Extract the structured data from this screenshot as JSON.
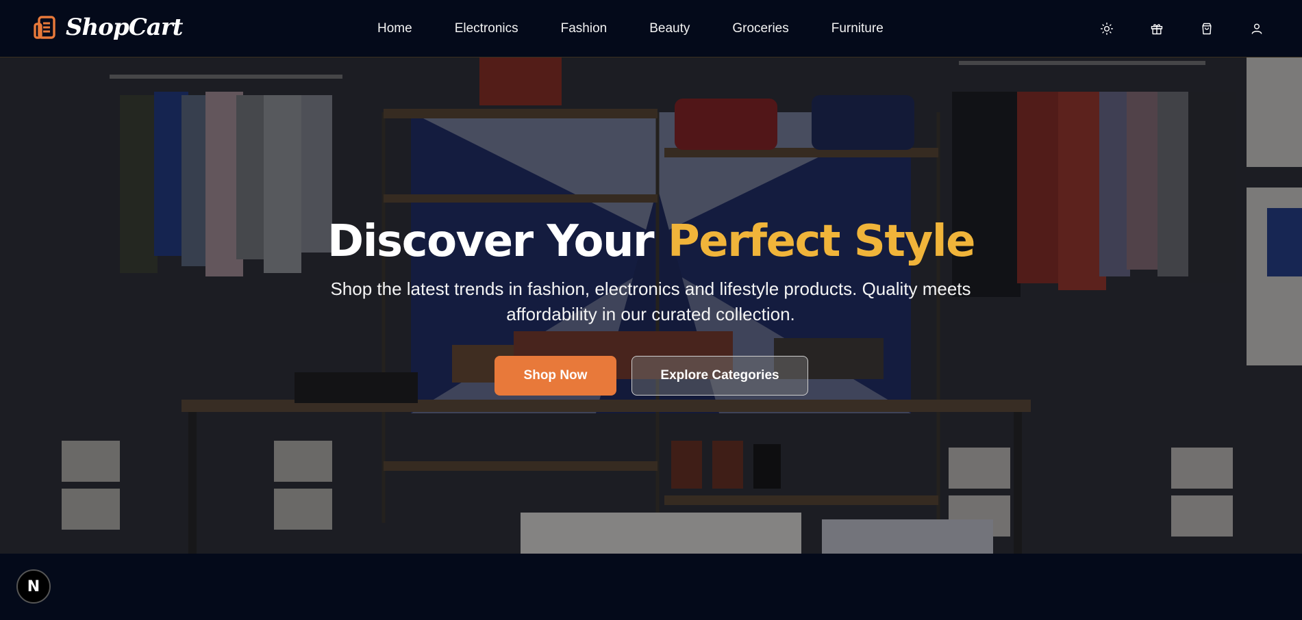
{
  "header": {
    "brand": "ShopCart",
    "nav": [
      "Home",
      "Electronics",
      "Fashion",
      "Beauty",
      "Groceries",
      "Furniture"
    ],
    "icons": [
      "sun-icon",
      "gift-icon",
      "shopping-bag-icon",
      "user-icon"
    ]
  },
  "hero": {
    "title_main": "Discover Your",
    "title_accent": "Perfect Style",
    "subtitle": "Shop the latest trends in fashion, electronics and lifestyle products. Quality meets affordability in our curated collection.",
    "primary_button": "Shop Now",
    "secondary_button": "Explore Categories"
  },
  "badge": {
    "label": "N"
  },
  "colors": {
    "background": "#040a1a",
    "accent_orange": "#e8793a",
    "accent_gold": "#f0b43a"
  }
}
